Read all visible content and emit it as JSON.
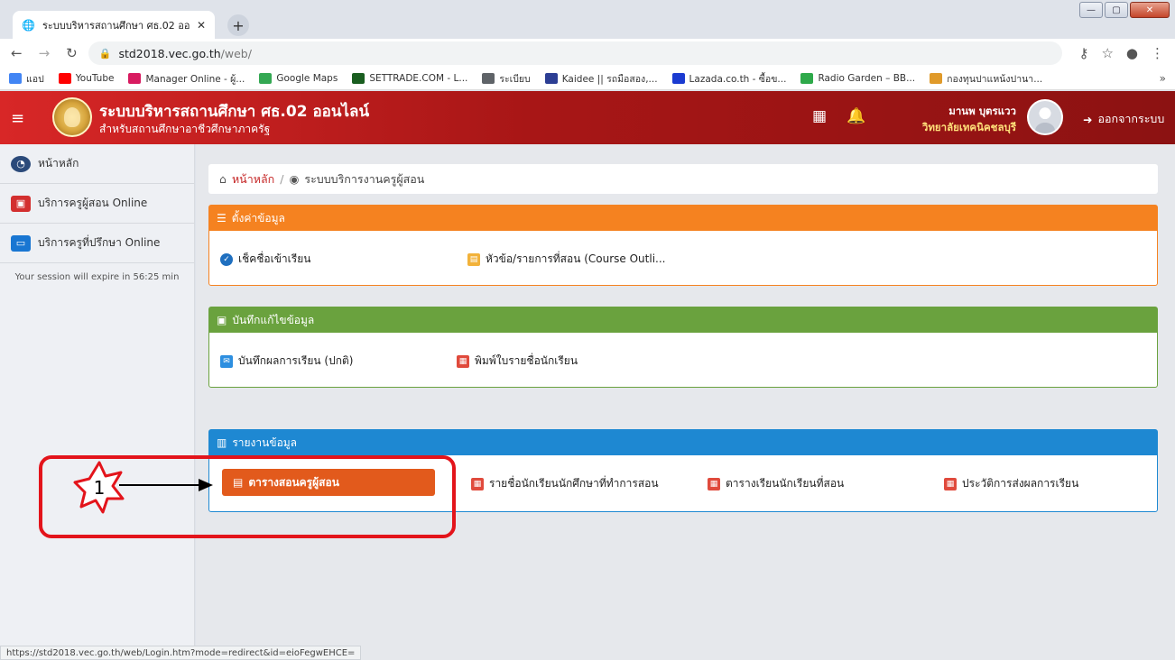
{
  "browser": {
    "tab_title": "ระบบบริหารสถานศึกษา ศธ.02 ออน",
    "tab_close": "✕",
    "new_tab": "+",
    "url_host": "std2018.vec.go.th",
    "url_path": "/web/",
    "window_controls": [
      "—",
      "▢",
      "✕"
    ],
    "bookmarks": [
      {
        "label": "แอป",
        "icon": "apps-icon",
        "color": "#4285f4"
      },
      {
        "label": "YouTube",
        "icon": "youtube-icon",
        "color": "#ff0000"
      },
      {
        "label": "Manager Online - ผู้...",
        "icon": "manager-icon",
        "color": "#d81b60"
      },
      {
        "label": "Google Maps",
        "icon": "maps-icon",
        "color": "#34a853"
      },
      {
        "label": "SETTRADE.COM - L...",
        "icon": "settrade-icon",
        "color": "#1a5e20"
      },
      {
        "label": "ระเบียบ",
        "icon": "globe-icon",
        "color": "#5f6368"
      },
      {
        "label": "Kaidee || รถมือสอง,...",
        "icon": "kaidee-icon",
        "color": "#2c3e94"
      },
      {
        "label": "Lazada.co.th - ซื้อข...",
        "icon": "lazada-icon",
        "color": "#1b3bd1"
      },
      {
        "label": "Radio Garden – BB...",
        "icon": "radio-icon",
        "color": "#2ea94a"
      },
      {
        "label": "กองทุนปาแหน้งปานา...",
        "icon": "fund-icon",
        "color": "#e09a2a"
      }
    ],
    "bookmarks_more": "»",
    "status_url": "https://std2018.vec.go.th/web/Login.htm?mode=redirect&id=eioFegwEHCE="
  },
  "header": {
    "title": "ระบบบริหารสถานศึกษา ศธ.02 ออนไลน์",
    "subtitle": "สำหรับสถานศึกษาอาชีวศึกษาภาครัฐ",
    "user_name": "มานพ บุตรแวว",
    "user_org": "วิทยาลัยเทคนิคชลบุรี",
    "logout_label": "ออกจากระบบ",
    "brand_color": "#b71c1c"
  },
  "sidebar": {
    "items": [
      {
        "label": "หน้าหลัก",
        "icon": "dashboard-icon",
        "color": "#2b4a7a"
      },
      {
        "label": "บริการครูผู้สอน Online",
        "icon": "teacher-icon",
        "color": "#d32f2f"
      },
      {
        "label": "บริการครูที่ปรึกษา Online",
        "icon": "monitor-icon",
        "color": "#1976d2"
      }
    ],
    "session_note": "Your session will expire in 56:25 min"
  },
  "breadcrumb": {
    "home": "หน้าหลัก",
    "separator": "/",
    "current": "ระบบบริการงานครูผู้สอน"
  },
  "panels": {
    "settings": {
      "title": "ตั้งค่าข้อมูล",
      "color": "#f58220",
      "links": [
        "เช็คชื่อเข้าเรียน",
        "หัวข้อ/รายการที่สอน (Course Outli..."
      ]
    },
    "records": {
      "title": "บันทึกแก้ไขข้อมูล",
      "color": "#6aa23e",
      "links": [
        "บันทึกผลการเรียน (ปกติ)",
        "พิมพ์ใบรายชื่อนักเรียน"
      ]
    },
    "reports": {
      "title": "รายงานข้อมูล",
      "color": "#1e88d2",
      "primary": "ตารางสอนครูผู้สอน",
      "links": [
        "รายชื่อนักเรียนนักศึกษาที่ทำการสอน",
        "ตารางเรียนนักเรียนที่สอน",
        "ประวัติการส่งผลการเรียน"
      ]
    }
  },
  "annotation": {
    "step_number": "1",
    "color": "#e3141b"
  }
}
